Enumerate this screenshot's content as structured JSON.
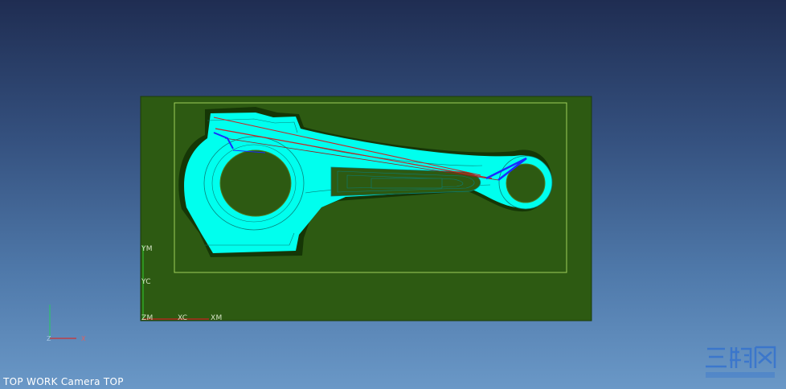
{
  "viewport": {
    "background_top": "#1f2d52",
    "background_bottom": "#6a98c7",
    "stock_color": "#2d5a12",
    "toolpath_color": "#00ffee",
    "rapid_color": "#cc2222",
    "engage_color": "#1a2cff"
  },
  "axes": {
    "ym": "YM",
    "yc": "YC",
    "zm": "ZM",
    "xc": "XC",
    "xm": "XM"
  },
  "triad": {
    "x": "X",
    "z": "Z"
  },
  "status": {
    "view_name": "TOP WORK Camera TOP"
  },
  "watermark": {
    "text": "三维网",
    "icon": "watermark-logo"
  }
}
